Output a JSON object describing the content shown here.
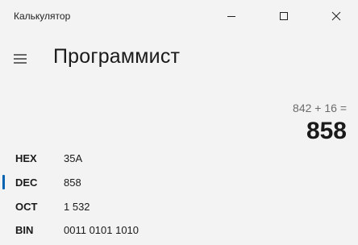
{
  "window": {
    "title": "Калькулятор",
    "controls": {
      "minimize_icon": "minimize-icon",
      "maximize_icon": "maximize-icon",
      "close_icon": "close-icon"
    }
  },
  "header": {
    "menu_icon": "hamburger-menu-icon",
    "mode_title": "Программист"
  },
  "display": {
    "expression": "842 + 16 =",
    "result": "858"
  },
  "radix": {
    "selected": "DEC",
    "accent_color": "#0063b1",
    "rows": [
      {
        "label": "HEX",
        "value": "35A"
      },
      {
        "label": "DEC",
        "value": "858"
      },
      {
        "label": "OCT",
        "value": "1 532"
      },
      {
        "label": "BIN",
        "value": "0011 0101 1010"
      }
    ]
  }
}
